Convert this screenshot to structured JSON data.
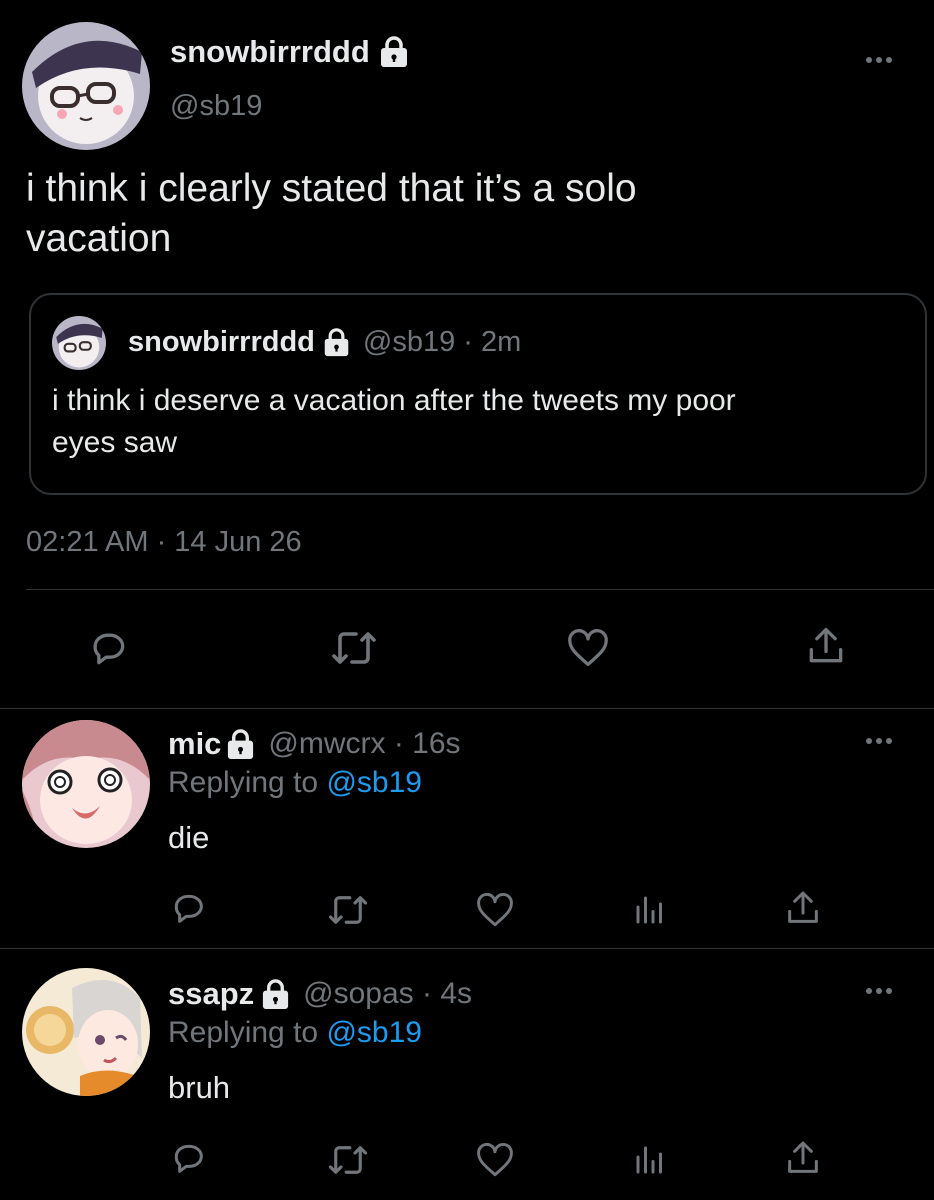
{
  "main_tweet": {
    "display_name": "snowbirrrddd",
    "handle": "@sb19",
    "text_line1": "i think i clearly stated that it’s a solo",
    "text_line2": "vacation",
    "timestamp": "02:21 AM · 14 Jun 26",
    "quoted": {
      "display_name": "snowbirrrddd",
      "handle_time": "@sb19 · 2m",
      "text_line1": "i think i deserve a vacation after the tweets my poor",
      "text_line2": "eyes saw"
    }
  },
  "replies": [
    {
      "display_name": "mic",
      "handle_time": "@mwcrx · 16s",
      "replying_prefix": "Replying to ",
      "replying_to": "@sb19",
      "text": "die"
    },
    {
      "display_name": "ssapz",
      "handle_time": "@sopas · 4s",
      "replying_prefix": "Replying to ",
      "replying_to": "@sb19",
      "text": "bruh"
    }
  ],
  "colors": {
    "background": "#000000",
    "text": "#e7e9ea",
    "muted": "#71767b",
    "link": "#1d9bf0",
    "divider": "#2f3336"
  },
  "icons": [
    "lock-icon",
    "more-icon",
    "reply-icon",
    "retweet-icon",
    "like-icon",
    "share-icon",
    "analytics-icon"
  ]
}
